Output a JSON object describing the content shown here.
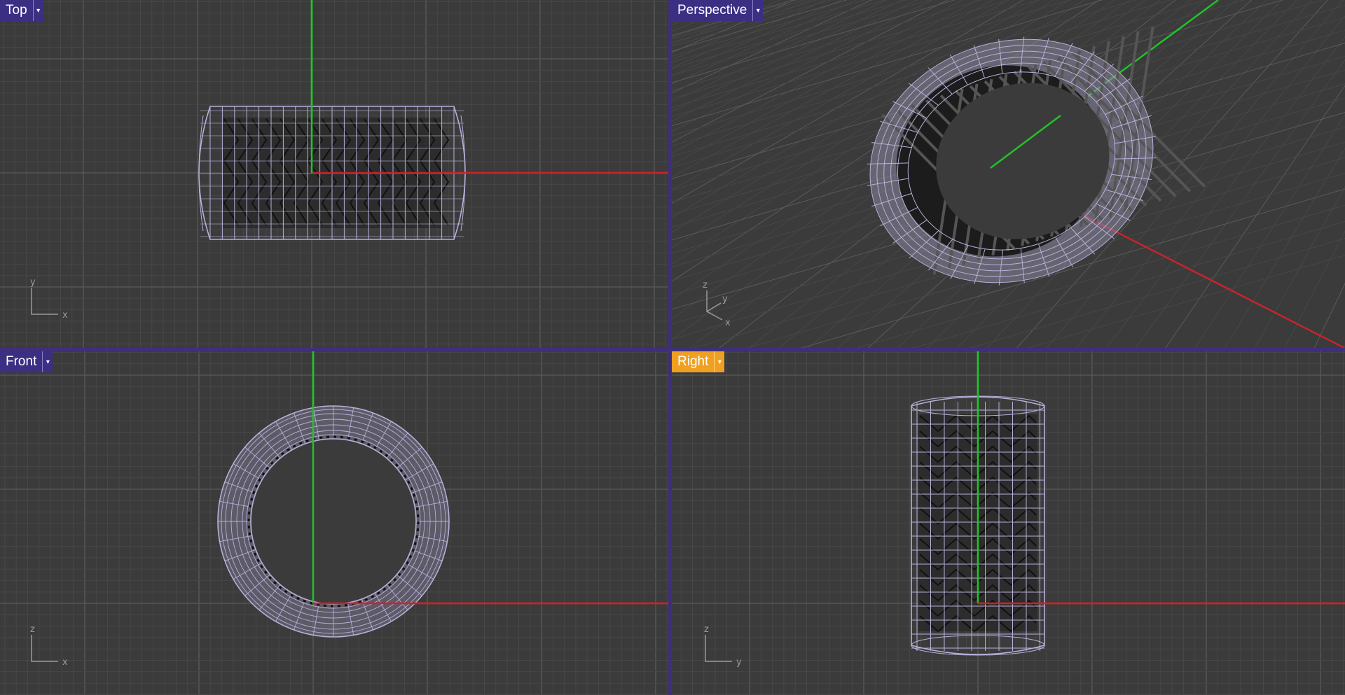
{
  "viewports": {
    "top": {
      "label": "Top",
      "active": false,
      "axis_h": "x",
      "axis_v": "y"
    },
    "persp": {
      "label": "Perspective",
      "active": false,
      "axis_1": "z",
      "axis_2": "y",
      "axis_3": "x"
    },
    "front": {
      "label": "Front",
      "active": false,
      "axis_h": "x",
      "axis_v": "z"
    },
    "right": {
      "label": "Right",
      "active": true,
      "axis_h": "y",
      "axis_v": "z"
    }
  },
  "dropdown_glyph": "▾",
  "colors": {
    "background": "#3b3b3b",
    "grid_minor": "#474747",
    "grid_major": "#5a5a5a",
    "axis_x": "#c8242a",
    "axis_y": "#22c22a",
    "wire": "#b8b0d8",
    "label_bg": "#3b2f84",
    "active_label_bg": "#f0a020",
    "frame": "#3f2f7a"
  }
}
